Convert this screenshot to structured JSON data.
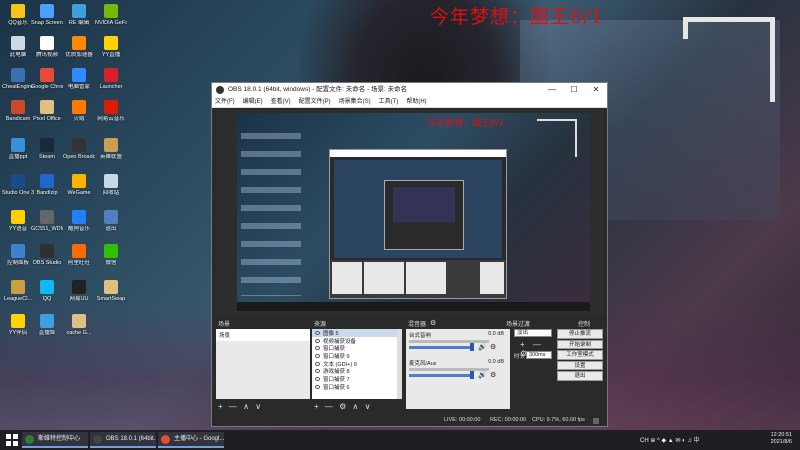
{
  "wallpaper": {
    "overlay_text": "今年梦想：国王0/1"
  },
  "desktop_icons": [
    {
      "label": "QQ音乐",
      "color": "#f7c515"
    },
    {
      "label": "Snap Screen 截图工具",
      "color": "#4aa0ff"
    },
    {
      "label": "RE 编辑",
      "color": "#3aa0e0"
    },
    {
      "label": "NVIDIA GeForce",
      "color": "#76b900"
    },
    {
      "label": "此电脑",
      "color": "#d0d8e8"
    },
    {
      "label": "腾讯视频",
      "color": "#ffffff"
    },
    {
      "label": "优质加速器",
      "color": "#ff8a00"
    },
    {
      "label": "YY直播",
      "color": "#ffd200"
    },
    {
      "label": "CheatEngine",
      "color": "#3a70b0"
    },
    {
      "label": "Google Chrome",
      "color": "#e84a3a"
    },
    {
      "label": "电脑管家",
      "color": "#2d8cff"
    },
    {
      "label": "Launcher",
      "color": "#d8202a"
    },
    {
      "label": "Bandicam",
      "color": "#c84a2a"
    },
    {
      "label": "Pixel Office",
      "color": "#e0c080"
    },
    {
      "label": "火绒",
      "color": "#ff7a00"
    },
    {
      "label": "网易云音乐",
      "color": "#d81e06"
    },
    {
      "label": "直播ppt",
      "color": "#3a90d8"
    },
    {
      "label": "Steam",
      "color": "#1b2838"
    },
    {
      "label": "Open Broadcaster",
      "color": "#333333"
    },
    {
      "label": "英雄联盟",
      "color": "#c9a050"
    },
    {
      "label": "Studio One 3",
      "color": "#1a4a8a"
    },
    {
      "label": "Bandizip",
      "color": "#2266cc"
    },
    {
      "label": "WeGame",
      "color": "#ffb400"
    },
    {
      "label": "回收站",
      "color": "#c8d8e8"
    },
    {
      "label": "YY语音",
      "color": "#ffd000"
    },
    {
      "label": "GC551_WDM",
      "color": "#666666"
    },
    {
      "label": "酷狗音乐",
      "color": "#2080ff"
    },
    {
      "label": "退出",
      "color": "#5080c0"
    },
    {
      "label": "控制面板",
      "color": "#4080d0"
    },
    {
      "label": "OBS Studio",
      "color": "#303030"
    },
    {
      "label": "阿里旺旺",
      "color": "#ff6a00"
    },
    {
      "label": "微信",
      "color": "#2dc100"
    },
    {
      "label": "LeagueCl...",
      "color": "#c8a040"
    },
    {
      "label": "QQ",
      "color": "#12b7f5"
    },
    {
      "label": "网易UU",
      "color": "#222222"
    },
    {
      "label": "SmartSwap",
      "color": "#e0c080"
    },
    {
      "label": "YY伴侣",
      "color": "#ffd200"
    },
    {
      "label": "直播姬",
      "color": "#3aa0e0"
    },
    {
      "label": "cache G...",
      "color": "#e0c080"
    }
  ],
  "obs": {
    "title": "OBS 18.0.1 (64bit, windows) - 配置文件: 未命名 - 场景: 未命名",
    "menu": [
      "文件(F)",
      "编辑(E)",
      "查看(V)",
      "配置文件(P)",
      "场景集合(S)",
      "工具(T)",
      "帮助(H)"
    ],
    "window_controls": {
      "minimize": "—",
      "maximize": "☐",
      "close": "✕"
    },
    "preview_overlay_text": "今年梦想：国王0/1",
    "dock_titles": {
      "scenes": "场景",
      "sources": "来源",
      "mixer": "混音器",
      "transitions": "场景过渡",
      "controls": "控制"
    },
    "scenes": [
      "场景"
    ],
    "sources": [
      {
        "label": "图像 5",
        "selected": true
      },
      {
        "label": "视频捕获设备",
        "selected": false
      },
      {
        "label": "窗口捕获",
        "selected": false
      },
      {
        "label": "窗口捕获 9",
        "selected": false
      },
      {
        "label": "文本 (GDI+) 9",
        "selected": false
      },
      {
        "label": "游戏捕获 8",
        "selected": false
      },
      {
        "label": "窗口捕获 7",
        "selected": false
      },
      {
        "label": "窗口捕获 6",
        "selected": false
      }
    ],
    "mixer": [
      {
        "name": "台式音响",
        "db": "0.0 dB"
      },
      {
        "name": "麦克风/Aux",
        "db": "0.0 dB"
      }
    ],
    "transition": {
      "selected": "淡出",
      "tools": "+ — ⚙",
      "duration_label": "时长",
      "duration": "300ms"
    },
    "controls": [
      "停止推流",
      "开始录制",
      "工作室模式",
      "设置",
      "退出"
    ],
    "dock_tools": {
      "scenes": "+ — ∧ ∨",
      "sources": "+ — ⚙ ∧ ∨"
    },
    "status": {
      "live": "LIVE: 00:00:00",
      "rec": "REC: 00:00:00",
      "cpu": "CPU: 9.7%, 60.00 fps"
    }
  },
  "taskbar": {
    "apps": [
      {
        "label": "斯维特控制中心",
        "color": "#2e7d32"
      },
      {
        "label": "OBS 18.0.1 (64bit...",
        "color": "#444444"
      },
      {
        "label": "主播中心 - Googl...",
        "color": "#e84a3a"
      }
    ],
    "tray": "CH  ⊕  ^  ◆  ▲  ✉  ◐  ♫  中",
    "time": "12:20:51",
    "date": "2021/8/6"
  }
}
